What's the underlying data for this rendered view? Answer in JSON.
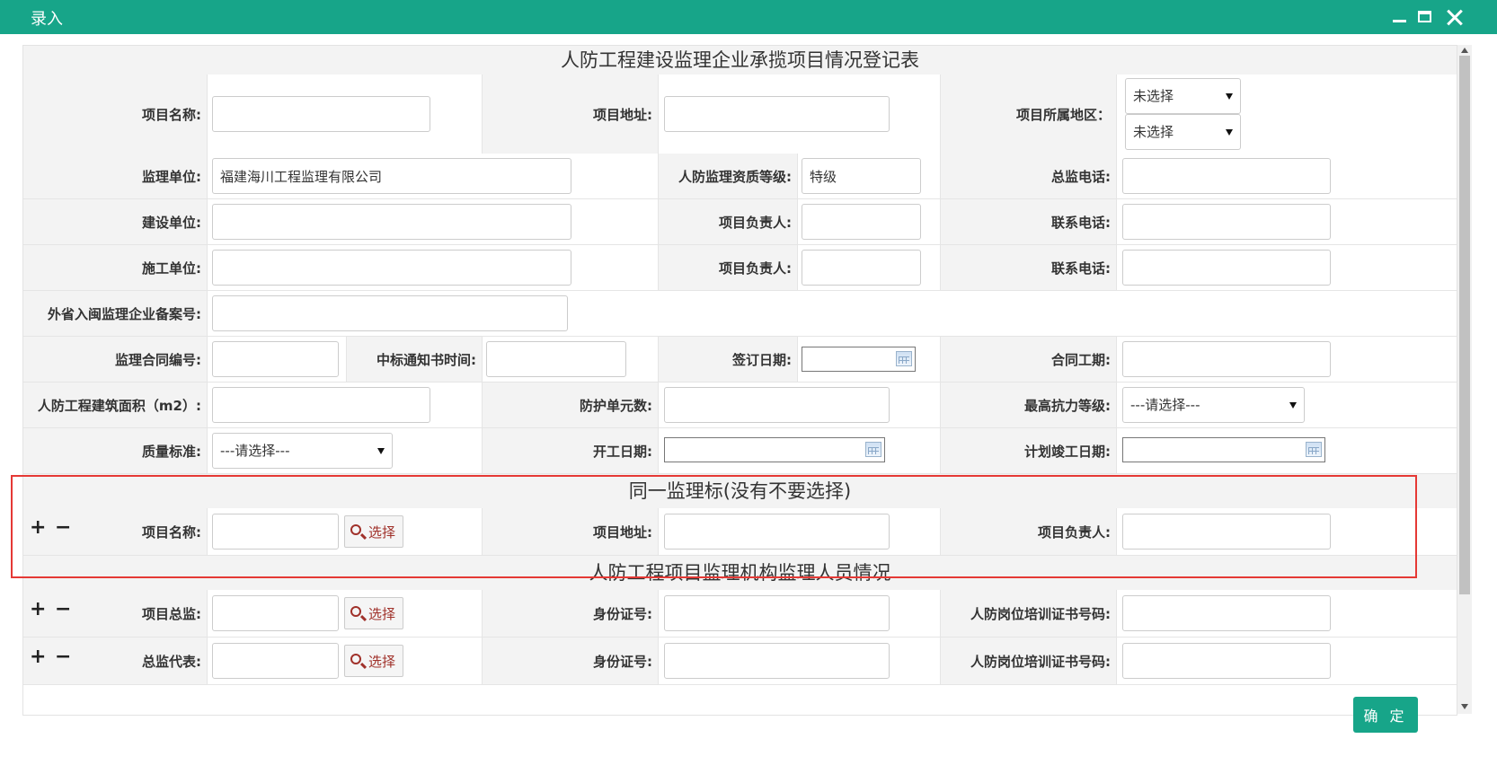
{
  "window": {
    "title": "录入"
  },
  "sections": {
    "main_title": "人防工程建设监理企业承揽项目情况登记表",
    "same_bid_title": "同一监理标(没有不要选择)",
    "staff_title": "人防工程项目监理机构监理人员情况"
  },
  "labels": {
    "project_name": "项目名称:",
    "project_address": "项目地址:",
    "project_region": "项目所属地区：",
    "supervision_unit": "监理单位:",
    "qualification_level": "人防监理资质等级:",
    "chief_phone": "总监电话:",
    "construction_unit": "建设单位:",
    "project_manager_1": "项目负责人:",
    "contact_phone_1": "联系电话:",
    "builder_unit": "施工单位:",
    "project_manager_2": "项目负责人:",
    "contact_phone_2": "联系电话:",
    "outside_record_no": "外省入闽监理企业备案号:",
    "contract_no": "监理合同编号:",
    "bid_notice_time": "中标通知书时间:",
    "sign_date": "签订日期:",
    "contract_period": "合同工期:",
    "building_area": "人防工程建筑面积（m2）:",
    "protection_units": "防护单元数:",
    "max_resistance": "最高抗力等级:",
    "quality_standard": "质量标准:",
    "start_date": "开工日期:",
    "planned_finish_date": "计划竣工日期:",
    "same_project_name": "项目名称:",
    "same_project_address": "项目地址:",
    "same_project_manager": "项目负责人:",
    "chief_supervisor": "项目总监:",
    "id_no_1": "身份证号:",
    "cert_no_1": "人防岗位培训证书号码:",
    "chief_rep": "总监代表:",
    "id_no_2": "身份证号:",
    "cert_no_2": "人防岗位培训证书号码:"
  },
  "values": {
    "supervision_unit": "福建海川工程监理有限公司",
    "qualification_level": "特级"
  },
  "selects": {
    "region_1": "未选择",
    "region_2": "未选择",
    "max_resistance": "---请选择---",
    "quality_standard": "---请选择---"
  },
  "buttons": {
    "choose": "选择",
    "plus": "+",
    "minus": "−",
    "ok": "确 定"
  },
  "colors": {
    "titlebar": "#17a589",
    "highlight_box": "#e53935",
    "choose_text": "#a0312a"
  }
}
